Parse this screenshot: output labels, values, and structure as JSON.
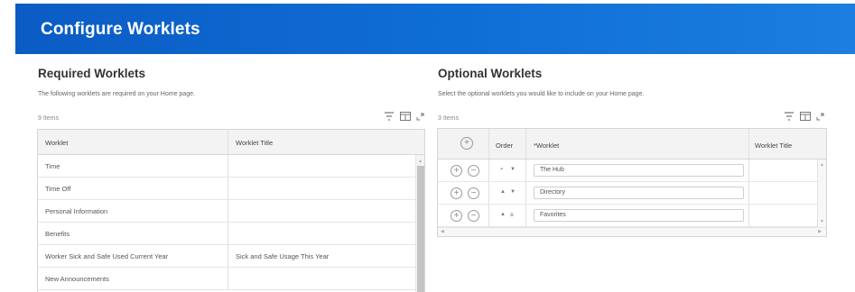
{
  "header": {
    "title": "Configure Worklets"
  },
  "required": {
    "title": "Required Worklets",
    "description": "The following worklets are required on your Home page.",
    "count": "9 Items",
    "columns": [
      "Worklet",
      "Worklet Title"
    ],
    "rows": [
      {
        "worklet": "Time",
        "title": ""
      },
      {
        "worklet": "Time Off",
        "title": ""
      },
      {
        "worklet": "Personal Information",
        "title": ""
      },
      {
        "worklet": "Benefits",
        "title": ""
      },
      {
        "worklet": "Worker Sick and Safe Used Current Year",
        "title": "Sick and Safe Usage This Year"
      },
      {
        "worklet": "New Announcements",
        "title": ""
      }
    ]
  },
  "optional": {
    "title": "Optional Worklets",
    "description": "Select the optional worklets you would like to include on your Home page.",
    "count": "3 Items",
    "columns": {
      "order": "Order",
      "worklet": "*Worklet",
      "title": "Worklet Title"
    },
    "rows": [
      {
        "worklet": "The Hub",
        "title": ""
      },
      {
        "worklet": "Directory",
        "title": ""
      },
      {
        "worklet": "Favorites",
        "title": ""
      }
    ]
  },
  "icons": {
    "filter": "filter-icon",
    "columns": "column-chooser-icon",
    "expand": "expand-icon",
    "add": "plus-circle-icon",
    "remove": "minus-circle-icon",
    "move_up": "arrow-up-icon",
    "move_down": "arrow-down-icon",
    "move_top": "arrow-top-icon",
    "move_bottom": "arrow-bottom-icon"
  },
  "colors": {
    "header_start": "#0b5cc4",
    "header_end": "#1c7ee0"
  }
}
